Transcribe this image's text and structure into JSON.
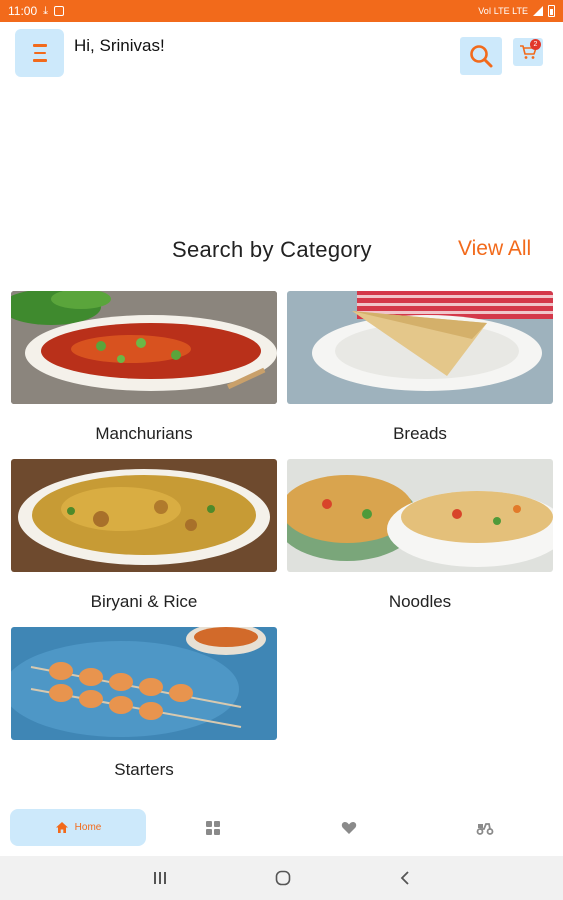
{
  "status_bar": {
    "time": "11:00",
    "network_text": "VoI LTE LTE"
  },
  "header": {
    "greeting": "Hi, Srinivas!",
    "cart_count": "2"
  },
  "section": {
    "title": "Search by Category",
    "view_all": "View All"
  },
  "categories": [
    {
      "label": "Manchurians"
    },
    {
      "label": "Breads"
    },
    {
      "label": "Biryani & Rice"
    },
    {
      "label": "Noodles"
    },
    {
      "label": "Starters"
    }
  ],
  "bottom_nav": {
    "home_label": "Home",
    "active": "home",
    "icons": [
      "home-icon",
      "grid-icon",
      "heart-icon",
      "scooter-icon"
    ]
  },
  "colors": {
    "accent": "#f26a1b",
    "button_bg": "#cde9fb",
    "badge": "#e2382a"
  }
}
